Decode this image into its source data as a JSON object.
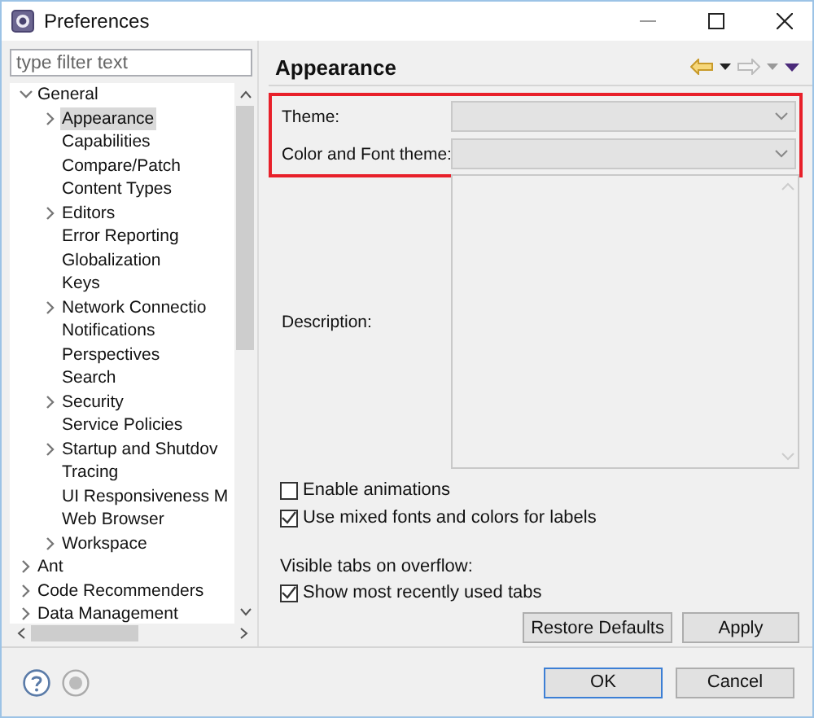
{
  "window": {
    "title": "Preferences"
  },
  "filter": {
    "placeholder": "type filter text"
  },
  "tree": [
    {
      "label": "General",
      "expanded": true,
      "selected": false,
      "children": [
        {
          "label": "Appearance",
          "expanded": false,
          "selected": true
        },
        {
          "label": "Capabilities",
          "selected": false
        },
        {
          "label": "Compare/Patch",
          "selected": false
        },
        {
          "label": "Content Types",
          "selected": false
        },
        {
          "label": "Editors",
          "expanded": false,
          "selected": false
        },
        {
          "label": "Error Reporting",
          "selected": false
        },
        {
          "label": "Globalization",
          "selected": false
        },
        {
          "label": "Keys",
          "selected": false
        },
        {
          "label": "Network Connectio",
          "expanded": false,
          "selected": false
        },
        {
          "label": "Notifications",
          "selected": false
        },
        {
          "label": "Perspectives",
          "selected": false
        },
        {
          "label": "Search",
          "selected": false
        },
        {
          "label": "Security",
          "expanded": false,
          "selected": false
        },
        {
          "label": "Service Policies",
          "selected": false
        },
        {
          "label": "Startup and Shutdov",
          "expanded": false,
          "selected": false
        },
        {
          "label": "Tracing",
          "selected": false
        },
        {
          "label": "UI Responsiveness M",
          "selected": false
        },
        {
          "label": "Web Browser",
          "selected": false
        },
        {
          "label": "Workspace",
          "expanded": false,
          "selected": false
        }
      ]
    },
    {
      "label": "Ant",
      "expanded": false,
      "selected": false
    },
    {
      "label": "Code Recommenders",
      "expanded": false,
      "selected": false
    },
    {
      "label": "Data Management",
      "expanded": false,
      "selected": false
    }
  ],
  "page": {
    "title": "Appearance",
    "combos": [
      {
        "label": "Theme:",
        "disabled": true
      },
      {
        "label": "Color and Font theme:",
        "disabled": true
      }
    ],
    "description_label": "Description:",
    "checkboxes": [
      {
        "label": "Enable animations",
        "checked": false
      },
      {
        "label": "Use mixed fonts and colors for labels",
        "checked": true
      }
    ],
    "tabs_label": "Visible tabs on overflow:",
    "tabs_checkboxes": [
      {
        "label": "Show most recently used tabs",
        "checked": true
      }
    ],
    "buttons": [
      "Restore Defaults",
      "Apply"
    ]
  },
  "footer_buttons": [
    {
      "label": "OK",
      "default": true
    },
    {
      "label": "Cancel",
      "default": false
    }
  ]
}
